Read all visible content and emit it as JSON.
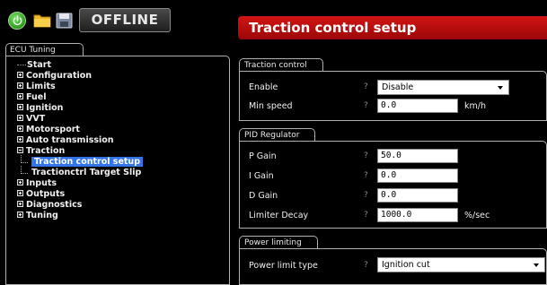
{
  "toolbar": {
    "status_label": "OFFLINE",
    "icons": [
      "power-icon",
      "folder-icon",
      "save-icon"
    ]
  },
  "tree": {
    "tab_label": "ECU Tuning",
    "items": [
      {
        "label": "Start",
        "type": "leaf"
      },
      {
        "label": "Configuration",
        "type": "collapsed"
      },
      {
        "label": "Limits",
        "type": "collapsed"
      },
      {
        "label": "Fuel",
        "type": "collapsed"
      },
      {
        "label": "Ignition",
        "type": "collapsed"
      },
      {
        "label": "VVT",
        "type": "collapsed"
      },
      {
        "label": "Motorsport",
        "type": "collapsed"
      },
      {
        "label": "Auto transmission",
        "type": "collapsed"
      },
      {
        "label": "Traction",
        "type": "expanded"
      },
      {
        "label": "Traction control setup",
        "type": "child-selected"
      },
      {
        "label": "Tractionctrl Target Slip",
        "type": "child"
      },
      {
        "label": "Inputs",
        "type": "collapsed"
      },
      {
        "label": "Outputs",
        "type": "collapsed"
      },
      {
        "label": "Diagnostics",
        "type": "collapsed"
      },
      {
        "label": "Tuning",
        "type": "collapsed"
      }
    ]
  },
  "page": {
    "title": "Traction control setup"
  },
  "traction_control": {
    "group_label": "Traction control",
    "enable_label": "Enable",
    "enable_value": "Disable",
    "min_speed_label": "Min speed",
    "min_speed_value": "0.0",
    "min_speed_unit": "km/h",
    "help": "?"
  },
  "pid": {
    "group_label": "PID Regulator",
    "p_label": "P Gain",
    "p_value": "50.0",
    "i_label": "I Gain",
    "i_value": "0.0",
    "d_label": "D Gain",
    "d_value": "0.0",
    "decay_label": "Limiter Decay",
    "decay_value": "1000.0",
    "decay_unit": "%/sec",
    "help": "?"
  },
  "power_limiting": {
    "group_label": "Power limiting",
    "type_label": "Power limit type",
    "type_value": "Ignition cut",
    "help": "?"
  },
  "colors": {
    "header_red": "#c00d0d",
    "selection_blue": "#3374e8",
    "background": "#000000"
  }
}
